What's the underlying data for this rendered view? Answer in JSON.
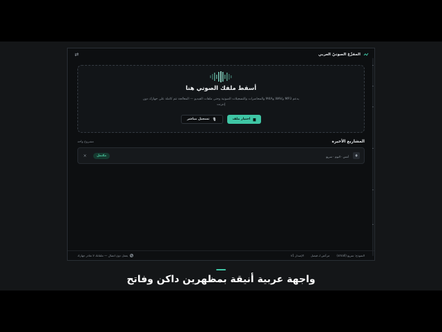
{
  "app": {
    "title": "المفرِّغ الصوتيّ العربي",
    "settings_icon": "settings-sliders-icon",
    "accent_color": "#3fc6a5"
  },
  "dropzone": {
    "title": "أسقط ملفك الصوتي هنا",
    "description": "يدعم MP3 وWAV وM4A والمحاضرات والتسجيلات الصوتية وحتى ملفات الفيديو — المعالجة تتم كاملة على جهازك دون إنترنت",
    "choose_file_label": "اختيار ملف",
    "choose_file_icon": "folder-icon",
    "record_label": "تسجيل مباشر",
    "record_icon": "microphone-icon"
  },
  "recent": {
    "title": "المشاريع الأخيرة",
    "count": "مشروع واحد",
    "items": [
      {
        "name": "",
        "meta": "أمس · اليوم · سريع",
        "status": "مكتمل",
        "status_color": "#4fd3a8"
      }
    ]
  },
  "statusbar": {
    "model": "النموذج: سريع (small)",
    "license": "مرخّص لـ فيصل",
    "version": "الإصدار v1",
    "offline": "يعمل دون اتصال — ملفاتك لا تغادر جهازك"
  },
  "caption": {
    "text": "واجهة عربية أنيقة بمظهرين داكن وفاتح"
  }
}
